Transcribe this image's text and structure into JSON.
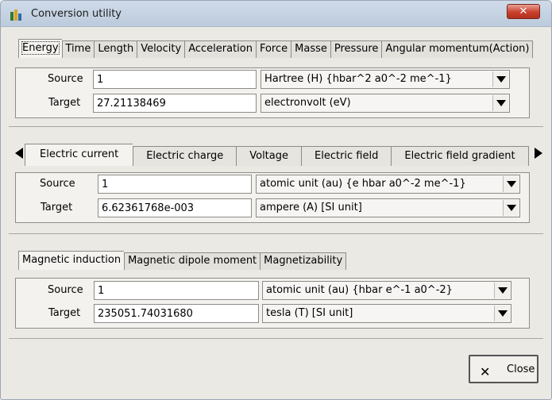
{
  "window": {
    "title": "Conversion utility",
    "close_glyph": "✕"
  },
  "energy_section": {
    "tabs": [
      "Energy",
      "Time",
      "Length",
      "Velocity",
      "Acceleration",
      "Force",
      "Masse",
      "Pressure",
      "Angular momentum(Action)"
    ],
    "active_tab": "Energy",
    "source_label": "Source",
    "target_label": "Target",
    "source_value": "1",
    "target_value": "27.21138469",
    "source_unit": "Hartree (H) {hbar^2 a0^-2 me^-1}",
    "target_unit": "electronvolt (eV)"
  },
  "electric_section": {
    "tabs": [
      "Electric current",
      "Electric charge",
      "Voltage",
      "Electric field",
      "Electric field gradient"
    ],
    "active_tab": "Electric current",
    "source_label": "Source",
    "target_label": "Target",
    "source_value": "1",
    "target_value": "6.62361768e-003",
    "source_unit": "atomic unit (au) {e hbar a0^-2 me^-1}",
    "target_unit": "ampere (A) [SI unit]"
  },
  "magnetic_section": {
    "tabs": [
      "Magnetic induction",
      "Magnetic dipole moment",
      "Magnetizability"
    ],
    "active_tab": "Magnetic induction",
    "source_label": "Source",
    "target_label": "Target",
    "source_value": "1",
    "target_value": "235051.74031680",
    "source_unit": "atomic unit (au) {hbar e^-1 a0^-2}",
    "target_unit": "tesla (T) [SI unit]"
  },
  "footer": {
    "close_label": "Close",
    "close_icon": "✕"
  },
  "icons": {
    "app": "app-icon",
    "dropdown": "chevron-down-icon",
    "scroll_left": "scroll-left-icon",
    "scroll_right": "scroll-right-icon"
  }
}
